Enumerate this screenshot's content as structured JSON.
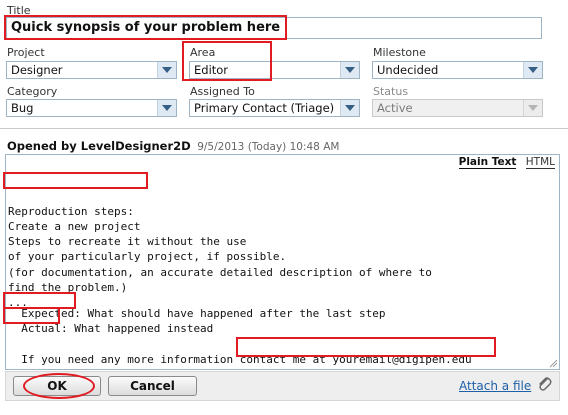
{
  "form": {
    "title_label": "Title",
    "title_value": "Quick synopsis of your problem here",
    "project_label": "Project",
    "project_value": "Designer",
    "area_label": "Area",
    "area_value": "Editor",
    "milestone_label": "Milestone",
    "milestone_value": "Undecided",
    "category_label": "Category",
    "category_value": "Bug",
    "assigned_label": "Assigned To",
    "assigned_value": "Primary Contact (Triage)",
    "status_label": "Status",
    "status_value": "Active"
  },
  "opened": {
    "prefix": "Opened by LevelDesigner2D",
    "date": "9/5/2013 (Today) 10:48 AM"
  },
  "editor": {
    "mode_plain": "Plain Text",
    "mode_html": "HTML",
    "lines": [
      "Reproduction steps:",
      "Create a new project",
      "Steps to recreate it without the use",
      "of your particularly project, if possible.",
      "(for documentation, an accurate detailed description of where to",
      "find the problem.)",
      "...",
      "",
      "",
      "",
      "",
      ""
    ],
    "expected_label": "Expected:",
    "expected_text": " What should have happened after the last step",
    "actual_label": "Actual:",
    "actual_text": " What happened instead",
    "contact_prefix": "If you need any more information ",
    "contact_highlight": "contact me at youremail@digipen.edu"
  },
  "footer": {
    "ok_label": "OK",
    "cancel_label": "Cancel",
    "attach_label": "Attach a file"
  },
  "colors": {
    "annotation": "#e11b22",
    "link": "#1f5fa8"
  },
  "icons": [
    "chevron-down-icon",
    "paperclip-icon",
    "resize-grip-icon"
  ]
}
